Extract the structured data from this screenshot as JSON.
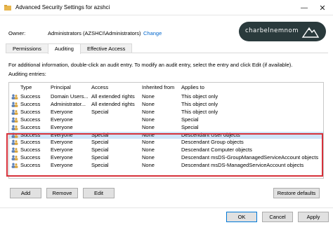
{
  "window": {
    "title": "Advanced Security Settings for azshci"
  },
  "owner": {
    "label": "Owner:",
    "value": "Administrators (AZSHCI\\Administrators)",
    "change_link": "Change"
  },
  "watermark": {
    "text": "charbelnemnom"
  },
  "tabs": [
    {
      "label": "Permissions"
    },
    {
      "label": "Auditing"
    },
    {
      "label": "Effective Access"
    }
  ],
  "info_text": "For additional information, double-click an audit entry. To modify an audit entry, select the entry and click Edit (if available).",
  "entries_label": "Auditing entries:",
  "table": {
    "columns": [
      "Type",
      "Principal",
      "Access",
      "Inherited from",
      "Applies to"
    ],
    "rows": [
      [
        "Success",
        "Domain Users...",
        "All extended rights",
        "None",
        "This object only"
      ],
      [
        "Success",
        "Administrator...",
        "All extended rights",
        "None",
        "This object only"
      ],
      [
        "Success",
        "Everyone",
        "Special",
        "None",
        "This object only"
      ],
      [
        "Success",
        "Everyone",
        "",
        "None",
        "Special"
      ],
      [
        "Success",
        "Everyone",
        "",
        "None",
        "Special"
      ],
      [
        "Success",
        "Everyone",
        "Special",
        "None",
        "Descendant User objects"
      ],
      [
        "Success",
        "Everyone",
        "Special",
        "None",
        "Descendant Group objects"
      ],
      [
        "Success",
        "Everyone",
        "Special",
        "None",
        "Descendant Computer objects"
      ],
      [
        "Success",
        "Everyone",
        "Special",
        "None",
        "Descendant msDS-GroupManagedServiceAccount objects"
      ],
      [
        "Success",
        "Everyone",
        "Special",
        "None",
        "Descendant msDS-ManagedServiceAccount objects"
      ]
    ]
  },
  "buttons": {
    "add": "Add",
    "remove": "Remove",
    "edit": "Edit",
    "restore": "Restore defaults",
    "ok": "OK",
    "cancel": "Cancel",
    "apply": "Apply"
  },
  "colors": {
    "highlight": "#d6313a",
    "link": "#0066cc",
    "selection": "#cfe4f7"
  }
}
